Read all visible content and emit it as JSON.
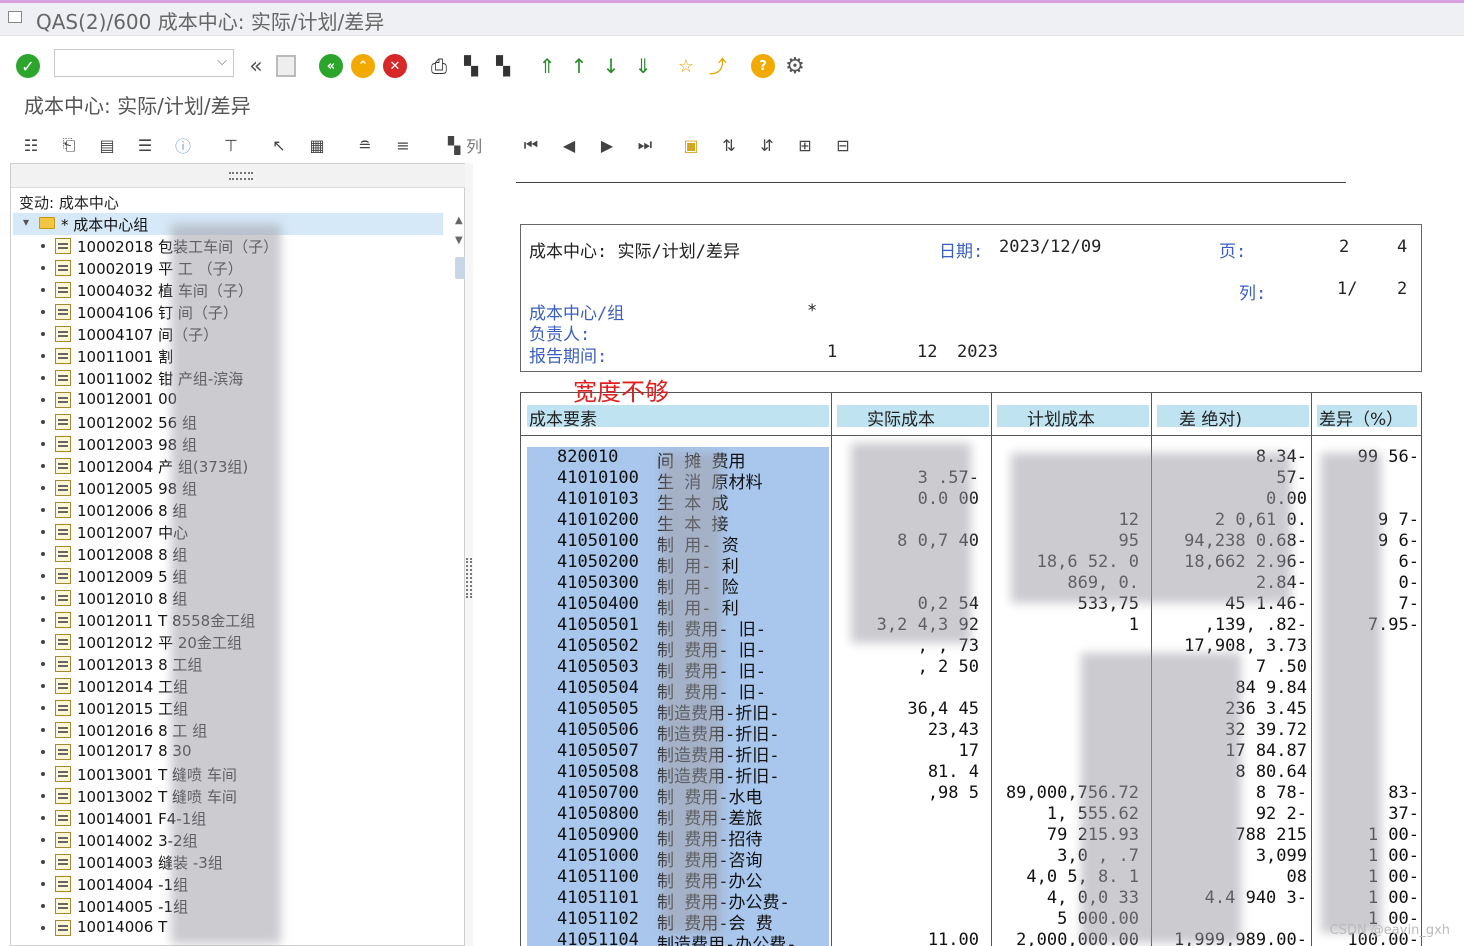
{
  "window": {
    "title": "QAS(2)/600 成本中心: 实际/计划/差异"
  },
  "toolbar": {
    "command_placeholder": "",
    "dropdown_glyph": "⌵"
  },
  "screen": {
    "subtitle": "成本中心: 实际/计划/差异"
  },
  "toolbar2": {
    "columns_label": "列"
  },
  "tree": {
    "header": "变动:  成本中心",
    "root": "* 成本中心组",
    "items": [
      "10002018 包装工车间（子）",
      "10002019 平    工   （子）",
      "10004032 植       车间（子）",
      "10004106 钉       间（子）",
      "10004107          间（子）",
      "10011001 割",
      "10011002       钳 产组-滨海",
      "10012001          00",
      "10012002         56  组",
      "10012003         98  组",
      "10012004          产 组(373组)",
      "10012005         98  组",
      "10012006          8  组",
      "10012007            中心",
      "10012008 8          组",
      "10012009 5          组",
      "10012010 8          组",
      "10012011 T        8558金工组",
      "10012012 平        20金工组",
      "10012013 8          工组",
      "10012014           工组",
      "10012015           工组",
      "10012016 8       工 组",
      "10012017 8       30",
      "10013001 T       缝喷 车间",
      "10013002 T       缝喷 车间",
      "10014001          F4-1组",
      "10014002          3-2组",
      "10014003         缝装   -3组",
      "10014004                -1组",
      "10014005                -1组",
      "10014006 T         "
    ]
  },
  "report": {
    "title": "成本中心:  实际/计划/差异",
    "date_label": "日期:",
    "date_value": "2023/12/09",
    "page_label": "页:",
    "page_value": "2",
    "page_total": "4",
    "col_label": "列:",
    "col_value": "1/",
    "col_total": "2",
    "cc_group_label": "成本中心/组",
    "cc_group_value": "*",
    "owner_label": "负责人:",
    "period_label": "报告期间:",
    "period_from": "1",
    "period_to": "12",
    "period_year": "2023",
    "annotation": "宽度不够"
  },
  "table": {
    "headers": {
      "element": "成本要素",
      "actual": "实际成本",
      "plan": "计划成本",
      "var_abs": "差   绝对)",
      "var_pct": "差异（%）"
    },
    "rows": [
      {
        "code": "820010",
        "desc": "间  摊    费用",
        "actual": "",
        "plan": "",
        "var": "8.34-",
        "pct": "99  56-"
      },
      {
        "code": "41010100",
        "desc": "生    消  原材料",
        "actual": "3  .57-",
        "plan": "",
        "var": "57-",
        "pct": ""
      },
      {
        "code": "41010103",
        "desc": "生    本  成",
        "actual": "  0.0   00",
        "plan": "",
        "var": "0.00",
        "pct": ""
      },
      {
        "code": "41010200",
        "desc": "生    本  接",
        "actual": "",
        "plan": "  12",
        "var": "2  0,61   0.",
        "pct": "9   7-"
      },
      {
        "code": "41050100",
        "desc": "制    用-  资",
        "actual": "8  0,7   40",
        "plan": "95",
        "var": "94,238   0.68-",
        "pct": "9   6-"
      },
      {
        "code": "41050200",
        "desc": "制    用-  利",
        "actual": "",
        "plan": "18,6    52. 0",
        "var": "18,662    2.96-",
        "pct": "   6-"
      },
      {
        "code": "41050300",
        "desc": "制    用-  险",
        "actual": "",
        "plan": "869,  0.",
        "var": "   2.84-",
        "pct": "   0-"
      },
      {
        "code": "41050400",
        "desc": "制    用-  利",
        "actual": "  0,2   54",
        "plan": "533,75",
        "var": "45    1.46-",
        "pct": "   7-"
      },
      {
        "code": "41050501",
        "desc": "制    费用-  旧-",
        "actual": "3,2 4,3  92",
        "plan": "1",
        "var": "  ,139,   .82-",
        "pct": "7.95-"
      },
      {
        "code": "41050502",
        "desc": "制    费用-  旧-",
        "actual": "  ,  ,  73",
        "plan": "",
        "var": "17,908,   3.73",
        "pct": ""
      },
      {
        "code": "41050503",
        "desc": "制    费用-  旧-",
        "actual": "  ,  2  50",
        "plan": "",
        "var": "7    .50",
        "pct": ""
      },
      {
        "code": "41050504",
        "desc": "制    费用-  旧-",
        "actual": "",
        "plan": "",
        "var": "84   9.84",
        "pct": ""
      },
      {
        "code": "41050505",
        "desc": "制造费用-折旧-",
        "actual": "36,4   45",
        "plan": "",
        "var": "236    3.45",
        "pct": ""
      },
      {
        "code": "41050506",
        "desc": "制造费用-折旧-",
        "actual": "23,43",
        "plan": "",
        "var": "32    39.72",
        "pct": ""
      },
      {
        "code": "41050507",
        "desc": "制造费用-折旧-",
        "actual": "17",
        "plan": "",
        "var": "17   84.87",
        "pct": ""
      },
      {
        "code": "41050508",
        "desc": "制造费用-折旧-",
        "actual": "81.   4",
        "plan": "",
        "var": "8  80.64",
        "pct": ""
      },
      {
        "code": "41050700",
        "desc": "制    费用-水电",
        "actual": "  ,98   5",
        "plan": "89,000,756.72",
        "var": "8     78-",
        "pct": "   83-"
      },
      {
        "code": "41050800",
        "desc": "制    费用-差旅",
        "actual": "",
        "plan": "1,    555.62",
        "var": "92    2-",
        "pct": "   37-"
      },
      {
        "code": "41050900",
        "desc": "制    费用-招待",
        "actual": "",
        "plan": "79  215.93",
        "var": "788  215",
        "pct": "1    00-"
      },
      {
        "code": "41051000",
        "desc": "制    费用-咨询",
        "actual": "",
        "plan": "3,0   ,   .7",
        "var": "3,099   ",
        "pct": "1    00-"
      },
      {
        "code": "41051100",
        "desc": "制    费用-办公",
        "actual": "",
        "plan": "4,0  5,  8.  1",
        "var": "  08   ",
        "pct": "1    00-"
      },
      {
        "code": "41051101",
        "desc": "制    费用-办公费-",
        "actual": "",
        "plan": "4,  0,0   33",
        "var": "4.4   940   3-",
        "pct": "1    00-"
      },
      {
        "code": "41051102",
        "desc": "制    费用-会  费",
        "actual": "",
        "plan": "5    000.00",
        "var": "",
        "pct": "1    00-"
      },
      {
        "code": "41051104",
        "desc": "制造费用-办公费-",
        "actual": "11.00",
        "plan": "2,000,000.00",
        "var": "1,999,989.00-",
        "pct": "100.00-"
      }
    ]
  },
  "watermark": "CSDN @eavin_gxh"
}
